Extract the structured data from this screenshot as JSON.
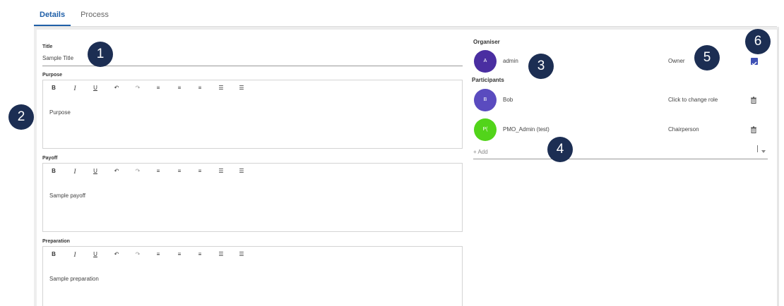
{
  "tabs": [
    {
      "label": "Details",
      "active": true
    },
    {
      "label": "Process",
      "active": false
    }
  ],
  "form": {
    "title_label": "Title",
    "title_value": "Sample Title",
    "editors": [
      {
        "label": "Purpose",
        "value": "Purpose"
      },
      {
        "label": "Payoff",
        "value": "Sample payoff"
      },
      {
        "label": "Preparation",
        "value": "Sample preparation"
      }
    ],
    "toolbar": {
      "bold": "B",
      "italic": "I",
      "underline": "U",
      "undo": "↶",
      "redo": "↷",
      "align_left": "≡",
      "align_center": "≡",
      "align_right": "≡",
      "ordered_list": "☰",
      "bullet_list": "☰"
    }
  },
  "organiser": {
    "title": "Organiser",
    "initial": "A",
    "name": "admin",
    "role": "Owner",
    "avatar_color": "#4a2ea1",
    "checked": true
  },
  "participants": {
    "title": "Participants",
    "items": [
      {
        "initial": "B",
        "name": "Bob",
        "role": "Click to change role",
        "avatar_color": "#5a4bbf"
      },
      {
        "initial": "P(",
        "name": "PMO_Admin (test)",
        "role": "Chairperson",
        "avatar_color": "#52d41a"
      }
    ],
    "add_placeholder": "+ Add"
  },
  "callouts": [
    "1",
    "2",
    "3",
    "4",
    "5",
    "6"
  ],
  "colors": {
    "accent": "#1f5fa8",
    "callout": "#1c2e53",
    "checkbox": "#3f51b5"
  }
}
